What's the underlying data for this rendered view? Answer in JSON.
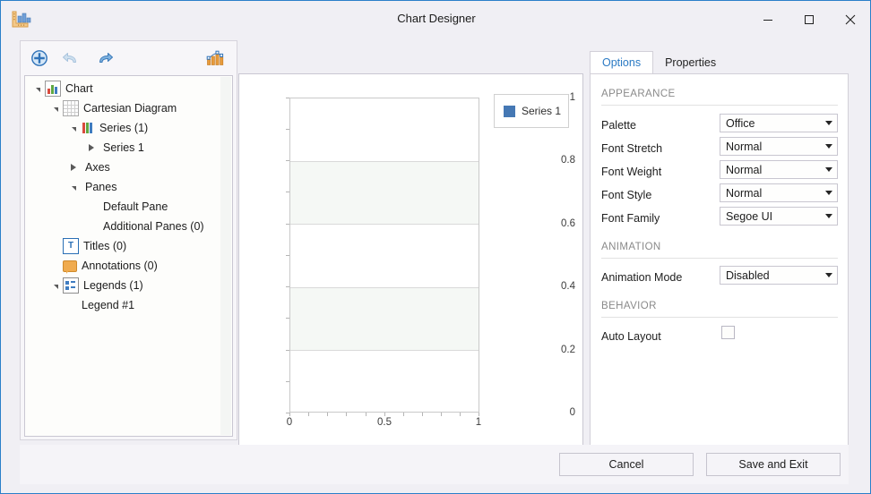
{
  "window": {
    "title": "Chart Designer",
    "app_icon": "bar-chart-ruler-icon",
    "controls": {
      "minimize": "—",
      "maximize": "❐",
      "close": "✕"
    }
  },
  "toolbar": {
    "add_label": "add-item",
    "undo_label": "undo",
    "redo_label": "redo",
    "wizard_label": "chart-wizard"
  },
  "tree": {
    "items": [
      {
        "label": "Chart",
        "indent": 0,
        "twisty": "expanded",
        "icon": "chart-icon"
      },
      {
        "label": "Cartesian Diagram",
        "indent": 1,
        "twisty": "expanded",
        "icon": "grid-icon"
      },
      {
        "label": "Series (1)",
        "indent": 2,
        "twisty": "expanded",
        "icon": "series-icon"
      },
      {
        "label": "Series 1",
        "indent": 3,
        "twisty": "collapsed",
        "icon": "none"
      },
      {
        "label": "Axes",
        "indent": 2,
        "twisty": "collapsed",
        "icon": "none"
      },
      {
        "label": "Panes",
        "indent": 2,
        "twisty": "expanded",
        "icon": "none"
      },
      {
        "label": "Default Pane",
        "indent": 3,
        "twisty": "none",
        "icon": "none"
      },
      {
        "label": "Additional Panes (0)",
        "indent": 3,
        "twisty": "none",
        "icon": "none"
      },
      {
        "label": "Titles (0)",
        "indent": 1,
        "twisty": "none",
        "icon": "titles-icon"
      },
      {
        "label": "Annotations (0)",
        "indent": 1,
        "twisty": "none",
        "icon": "annotations-icon"
      },
      {
        "label": "Legends (1)",
        "indent": 1,
        "twisty": "expanded",
        "icon": "legends-icon"
      },
      {
        "label": "Legend #1",
        "indent": 2,
        "twisty": "none",
        "icon": "none"
      }
    ]
  },
  "chart_data": {
    "type": "line",
    "title": "",
    "xlabel": "",
    "ylabel": "",
    "x": [],
    "series": [
      {
        "name": "Series 1",
        "color": "#4578b4",
        "values": []
      }
    ],
    "xlim": [
      0,
      1
    ],
    "ylim": [
      0,
      1
    ],
    "xticks": [
      "0",
      "0.5",
      "1"
    ],
    "xtick_values": [
      0,
      0.5,
      1
    ],
    "yticks": [
      "0",
      "0.2",
      "0.4",
      "0.6",
      "0.8",
      "1"
    ],
    "ytick_values": [
      0,
      0.2,
      0.4,
      0.6,
      0.8,
      1
    ],
    "grid": true,
    "alternating_bands": true,
    "band_color": "#f5f8f5",
    "legend": {
      "position": "top-right",
      "entries": [
        "Series 1"
      ]
    }
  },
  "properties": {
    "tabs": [
      {
        "label": "Options",
        "active": true
      },
      {
        "label": "Properties",
        "active": false
      }
    ],
    "sections": [
      {
        "title": "APPEARANCE",
        "rows": [
          {
            "label": "Palette",
            "value": "Office",
            "control": "combo"
          },
          {
            "label": "Font Stretch",
            "value": "Normal",
            "control": "combo"
          },
          {
            "label": "Font Weight",
            "value": "Normal",
            "control": "combo"
          },
          {
            "label": "Font Style",
            "value": "Normal",
            "control": "combo"
          },
          {
            "label": "Font Family",
            "value": "Segoe UI",
            "control": "combo"
          }
        ]
      },
      {
        "title": "ANIMATION",
        "rows": [
          {
            "label": "Animation Mode",
            "value": "Disabled",
            "control": "combo"
          }
        ]
      },
      {
        "title": "BEHAVIOR",
        "rows": [
          {
            "label": "Auto Layout",
            "value": "",
            "control": "checkbox",
            "checked": false
          }
        ]
      }
    ]
  },
  "footer": {
    "cancel_label": "Cancel",
    "save_label": "Save and Exit"
  },
  "colors": {
    "accent": "#2a7fc9",
    "tab_active_text": "#2b7ac4",
    "series_1": "#4578b4",
    "window_bg": "#f0eff4"
  }
}
